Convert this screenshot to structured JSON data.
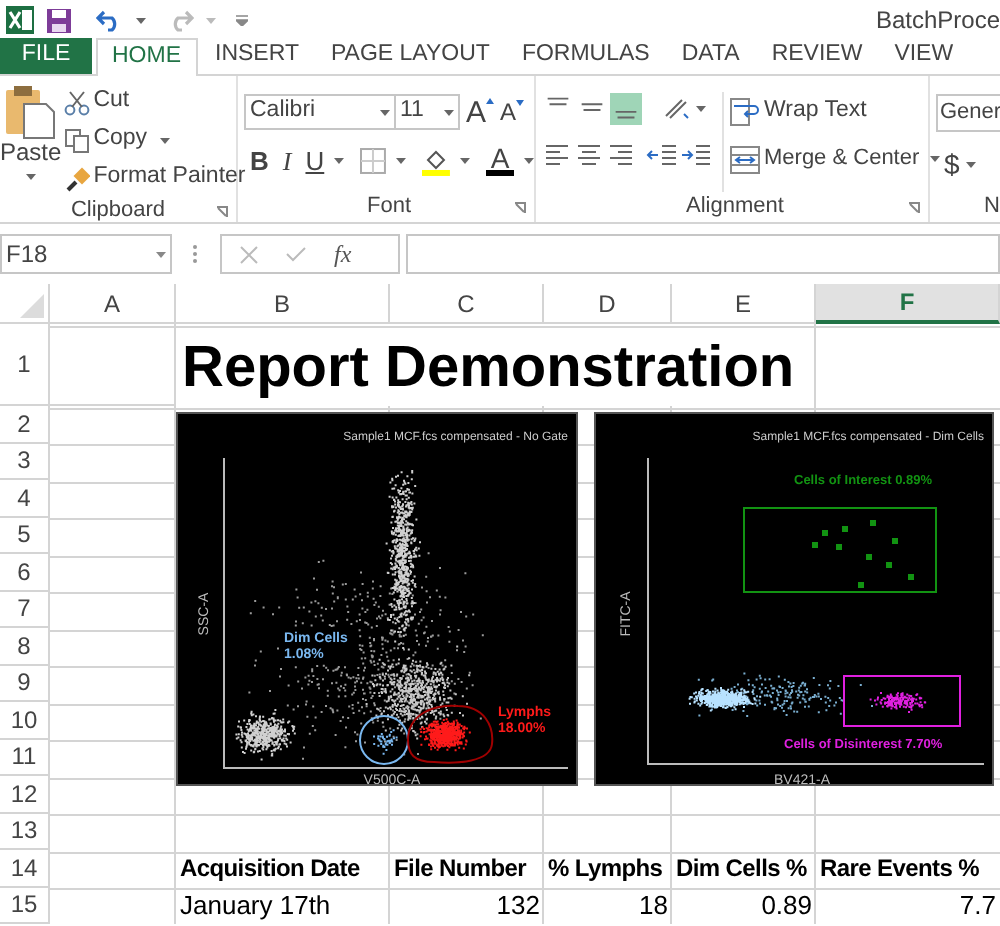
{
  "title_bar": {
    "title": "BatchProce"
  },
  "tabs": [
    {
      "label": "FILE",
      "kind": "file",
      "selected": false
    },
    {
      "label": "HOME",
      "kind": "tab",
      "selected": true
    },
    {
      "label": "INSERT",
      "kind": "tab",
      "selected": false
    },
    {
      "label": "PAGE LAYOUT",
      "kind": "tab",
      "selected": false
    },
    {
      "label": "FORMULAS",
      "kind": "tab",
      "selected": false
    },
    {
      "label": "DATA",
      "kind": "tab",
      "selected": false
    },
    {
      "label": "REVIEW",
      "kind": "tab",
      "selected": false
    },
    {
      "label": "VIEW",
      "kind": "tab",
      "selected": false
    }
  ],
  "ribbon": {
    "clipboard": {
      "label": "Clipboard",
      "paste": "Paste",
      "cut": "Cut",
      "copy": "Copy",
      "format_painter": "Format Painter"
    },
    "font": {
      "label": "Font",
      "font_name": "Calibri",
      "font_size": "11",
      "grow": "A",
      "shrink": "A",
      "bold": "B",
      "italic": "I",
      "underline": "U",
      "font_color": "A"
    },
    "alignment": {
      "label": "Alignment",
      "vertical": [
        {
          "selected": false
        },
        {
          "selected": false
        },
        {
          "selected": true
        }
      ],
      "wrap_text": "Wrap Text",
      "merge_center": "Merge & Center"
    },
    "number": {
      "label": "N",
      "format": "Gener",
      "currency": "$"
    }
  },
  "formula_bar": {
    "name_box": "F18",
    "fx": "fx"
  },
  "columns": [
    {
      "label": "A",
      "selected": false
    },
    {
      "label": "B",
      "selected": false
    },
    {
      "label": "C",
      "selected": false
    },
    {
      "label": "D",
      "selected": false
    },
    {
      "label": "E",
      "selected": false
    },
    {
      "label": "F",
      "selected": true
    }
  ],
  "rows": [
    "1",
    "2",
    "3",
    "4",
    "5",
    "6",
    "7",
    "8",
    "9",
    "10",
    "11",
    "12",
    "13",
    "14",
    "15"
  ],
  "report_title": "Report Demonstration",
  "plots": [
    {
      "kind": "scatter",
      "title": "Sample1 MCF.fcs compensated - No Gate",
      "x_label": "V500C-A",
      "y_label": "SSC-A",
      "gates": [
        {
          "label": "Dim Cells",
          "value": "1.08%",
          "color": "#7ab8f0"
        },
        {
          "label": "Lymphs",
          "value": "18.00%",
          "color": "#ff1a1a"
        }
      ]
    },
    {
      "kind": "gated",
      "title": "Sample1 MCF.fcs compensated - Dim Cells",
      "x_label": "BV421-A",
      "y_label": "FITC-A",
      "gates": [
        {
          "label": "Cells of Interest",
          "value": "0.89%",
          "color": "#129312"
        },
        {
          "label": "Cells of Disinterest",
          "value": "7.70%",
          "color": "#e020e0"
        }
      ]
    }
  ],
  "table": {
    "columns": [
      "Acquisition Date",
      "File Number",
      "% Lymphs",
      "Dim Cells %",
      "Rare Events %"
    ],
    "rows": [
      [
        "January 17th",
        "132",
        "18",
        "0.89",
        "7.7"
      ]
    ]
  }
}
